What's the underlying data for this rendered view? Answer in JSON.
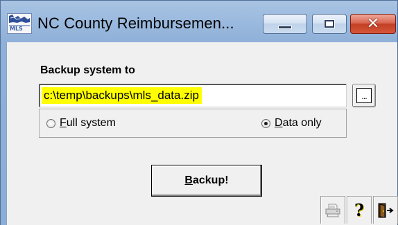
{
  "window": {
    "title": "NC County Reimbursemen...",
    "icon": "mls-app-icon",
    "controls": {
      "minimize": "minimize-icon",
      "maximize": "maximize-icon",
      "close": "close-icon"
    }
  },
  "backup": {
    "section_label": "Backup system to",
    "path_value": "c:\\temp\\backups\\mls_data.zip",
    "browse_label": "...",
    "options": [
      {
        "label": "Full system",
        "accel_char": "F",
        "rest": "ull system",
        "selected": false
      },
      {
        "label": "Data only",
        "accel_char": "D",
        "rest": "ata only",
        "selected": true
      }
    ],
    "button_label": "Backup!",
    "button_accel": "B",
    "button_rest": "ackup!"
  },
  "toolbar": {
    "print_icon": "printer-icon",
    "help_icon": "help-question-icon",
    "exit_icon": "exit-door-icon",
    "help_glyph": "?"
  },
  "colors": {
    "input_highlight": "#ffff00",
    "close_button": "#c94a30",
    "title_bar": "#9fbde0"
  }
}
